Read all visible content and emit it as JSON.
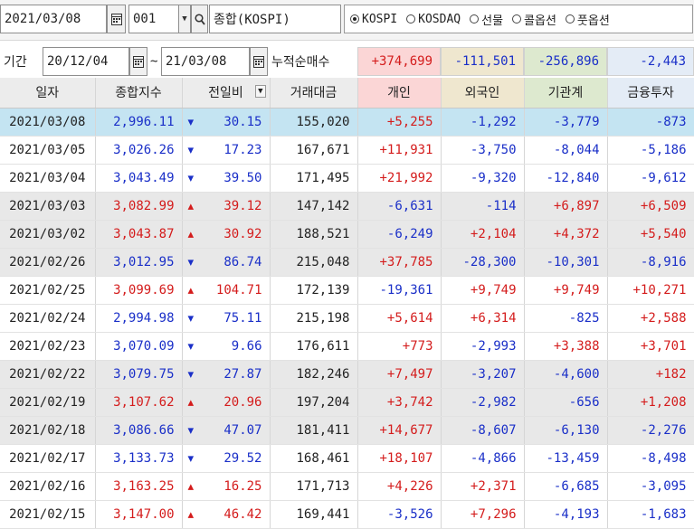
{
  "toolbar": {
    "date": "2021/03/08",
    "code": "001",
    "index_name": "종합(KOSPI)",
    "markets": [
      {
        "label": "KOSPI",
        "selected": true
      },
      {
        "label": "KOSDAQ",
        "selected": false
      },
      {
        "label": "선물",
        "selected": false
      },
      {
        "label": "콜옵션",
        "selected": false
      },
      {
        "label": "풋옵션",
        "selected": false
      }
    ]
  },
  "period": {
    "label": "기간",
    "start": "20/12/04",
    "tilde": "~",
    "end": "21/03/08",
    "cumulative_label": "누적순매수",
    "totals": {
      "individual": "+374,699",
      "foreign": "-111,501",
      "institution": "-256,896",
      "financial": "-2,443"
    }
  },
  "colors": {
    "up": "#d41c1c",
    "down": "#1a2fc8",
    "selected_row": "#c4e4f2"
  },
  "table": {
    "headers": [
      "일자",
      "종합지수",
      "전일비",
      "거래대금",
      "개인",
      "외국인",
      "기관계",
      "금융투자"
    ],
    "rows": [
      {
        "date": "2021/03/08",
        "index": "2,996.11",
        "dir": "down",
        "change": "30.15",
        "volume": "155,020",
        "individual": "+5,255",
        "foreign": "-1,292",
        "institution": "-3,779",
        "financial": "-873",
        "selected": true,
        "grey": false
      },
      {
        "date": "2021/03/05",
        "index": "3,026.26",
        "dir": "down",
        "change": "17.23",
        "volume": "167,671",
        "individual": "+11,931",
        "foreign": "-3,750",
        "institution": "-8,044",
        "financial": "-5,186",
        "selected": false,
        "grey": false
      },
      {
        "date": "2021/03/04",
        "index": "3,043.49",
        "dir": "down",
        "change": "39.50",
        "volume": "171,495",
        "individual": "+21,992",
        "foreign": "-9,320",
        "institution": "-12,840",
        "financial": "-9,612",
        "selected": false,
        "grey": false
      },
      {
        "date": "2021/03/03",
        "index": "3,082.99",
        "dir": "up",
        "change": "39.12",
        "volume": "147,142",
        "individual": "-6,631",
        "foreign": "-114",
        "institution": "+6,897",
        "financial": "+6,509",
        "selected": false,
        "grey": true
      },
      {
        "date": "2021/03/02",
        "index": "3,043.87",
        "dir": "up",
        "change": "30.92",
        "volume": "188,521",
        "individual": "-6,249",
        "foreign": "+2,104",
        "institution": "+4,372",
        "financial": "+5,540",
        "selected": false,
        "grey": true
      },
      {
        "date": "2021/02/26",
        "index": "3,012.95",
        "dir": "down",
        "change": "86.74",
        "volume": "215,048",
        "individual": "+37,785",
        "foreign": "-28,300",
        "institution": "-10,301",
        "financial": "-8,916",
        "selected": false,
        "grey": true
      },
      {
        "date": "2021/02/25",
        "index": "3,099.69",
        "dir": "up",
        "change": "104.71",
        "volume": "172,139",
        "individual": "-19,361",
        "foreign": "+9,749",
        "institution": "+9,749",
        "financial": "+10,271",
        "selected": false,
        "grey": false
      },
      {
        "date": "2021/02/24",
        "index": "2,994.98",
        "dir": "down",
        "change": "75.11",
        "volume": "215,198",
        "individual": "+5,614",
        "foreign": "+6,314",
        "institution": "-825",
        "financial": "+2,588",
        "selected": false,
        "grey": false
      },
      {
        "date": "2021/02/23",
        "index": "3,070.09",
        "dir": "down",
        "change": "9.66",
        "volume": "176,611",
        "individual": "+773",
        "foreign": "-2,993",
        "institution": "+3,388",
        "financial": "+3,701",
        "selected": false,
        "grey": false
      },
      {
        "date": "2021/02/22",
        "index": "3,079.75",
        "dir": "down",
        "change": "27.87",
        "volume": "182,246",
        "individual": "+7,497",
        "foreign": "-3,207",
        "institution": "-4,600",
        "financial": "+182",
        "selected": false,
        "grey": true
      },
      {
        "date": "2021/02/19",
        "index": "3,107.62",
        "dir": "up",
        "change": "20.96",
        "volume": "197,204",
        "individual": "+3,742",
        "foreign": "-2,982",
        "institution": "-656",
        "financial": "+1,208",
        "selected": false,
        "grey": true
      },
      {
        "date": "2021/02/18",
        "index": "3,086.66",
        "dir": "down",
        "change": "47.07",
        "volume": "181,411",
        "individual": "+14,677",
        "foreign": "-8,607",
        "institution": "-6,130",
        "financial": "-2,276",
        "selected": false,
        "grey": true
      },
      {
        "date": "2021/02/17",
        "index": "3,133.73",
        "dir": "down",
        "change": "29.52",
        "volume": "168,461",
        "individual": "+18,107",
        "foreign": "-4,866",
        "institution": "-13,459",
        "financial": "-8,498",
        "selected": false,
        "grey": false
      },
      {
        "date": "2021/02/16",
        "index": "3,163.25",
        "dir": "up",
        "change": "16.25",
        "volume": "171,713",
        "individual": "+4,226",
        "foreign": "+2,371",
        "institution": "-6,685",
        "financial": "-3,095",
        "selected": false,
        "grey": false
      },
      {
        "date": "2021/02/15",
        "index": "3,147.00",
        "dir": "up",
        "change": "46.42",
        "volume": "169,441",
        "individual": "-3,526",
        "foreign": "+7,296",
        "institution": "-4,193",
        "financial": "-1,683",
        "selected": false,
        "grey": false
      }
    ]
  }
}
